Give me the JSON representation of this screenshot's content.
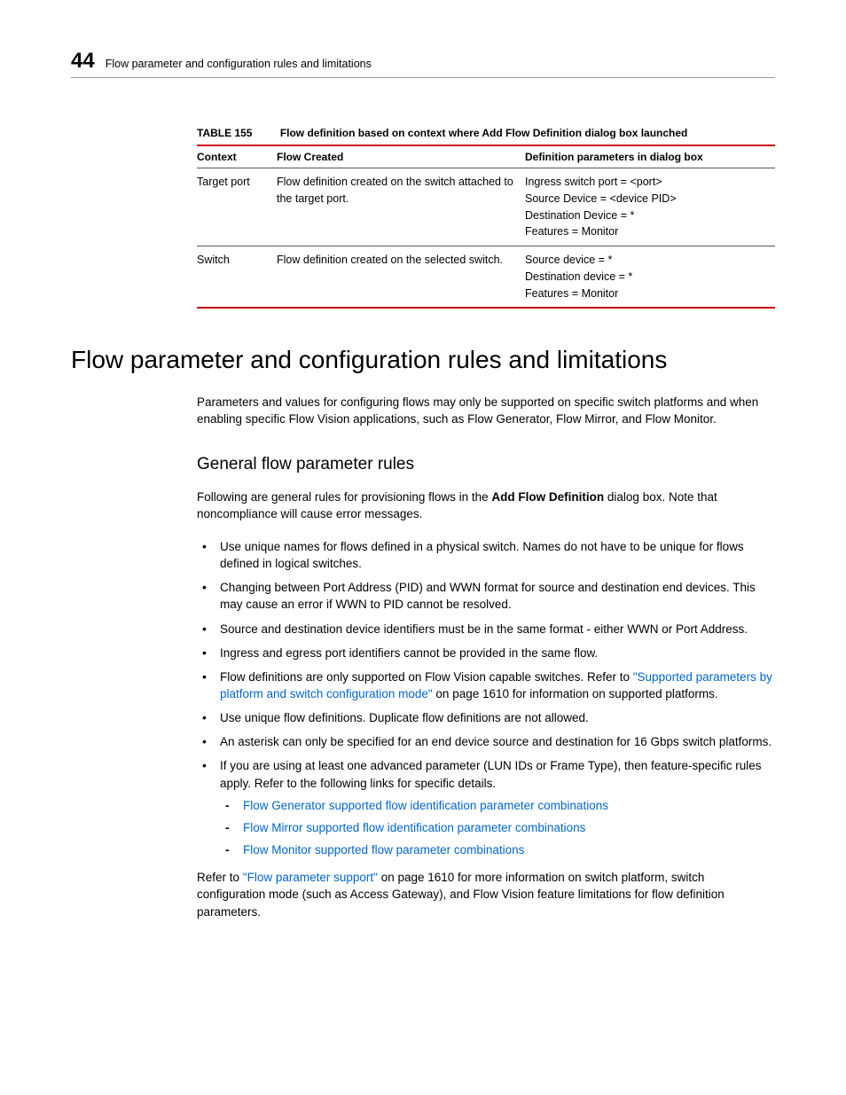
{
  "header": {
    "page_number": "44",
    "running_title": "Flow parameter and configuration rules and limitations"
  },
  "table": {
    "label": "TABLE 155",
    "caption": "Flow definition based on context where Add Flow Definition dialog box launched",
    "headers": [
      "Context",
      "Flow Created",
      "Definition parameters in dialog box"
    ],
    "rows": [
      {
        "context": "Target port",
        "flow_created": "Flow definition created on the switch attached to the target port.",
        "params": "Ingress switch port = <port>\nSource Device = <device PID>\nDestination Device = *\nFeatures = Monitor"
      },
      {
        "context": "Switch",
        "flow_created": "Flow definition created on the selected switch.",
        "params": "Source device = *\nDestination device = *\nFeatures = Monitor"
      }
    ]
  },
  "section": {
    "title": "Flow parameter and configuration rules and limitations",
    "intro": "Parameters and values for configuring flows may only be supported on specific switch platforms and when enabling specific Flow Vision applications, such as Flow Generator, Flow Mirror, and Flow Monitor.",
    "sub_title": "General flow parameter rules",
    "sub_intro_pre": "Following are general rules for provisioning flows in the ",
    "sub_intro_bold": "Add Flow Definition",
    "sub_intro_post": " dialog box. Note that noncompliance will cause error messages.",
    "bullets": {
      "b0": "Use unique names for flows defined in a physical switch. Names do not have to be unique for flows defined in logical switches.",
      "b1": "Changing between Port Address (PID) and WWN format for source and destination end devices. This may cause an error if WWN to PID cannot be resolved.",
      "b2": "Source and destination device identifiers must be in the same format - either WWN or Port Address.",
      "b3": "Ingress and egress port identifiers cannot be provided in the same flow.",
      "b4_pre": "Flow definitions are only supported on Flow Vision capable switches. Refer to ",
      "b4_link": "\"Supported parameters by platform and switch configuration mode\"",
      "b4_post": " on page 1610 for information on supported platforms.",
      "b5": "Use unique flow definitions. Duplicate flow definitions are not allowed.",
      "b6": "An asterisk can only be specified for an end device source and destination for 16 Gbps switch platforms.",
      "b7": "If you are using at least one advanced parameter (LUN IDs or Frame Type), then feature-specific rules apply. Refer to the following links for specific details.",
      "b7_sub0": "Flow Generator supported flow identification parameter combinations",
      "b7_sub1": "Flow Mirror supported flow identification parameter combinations",
      "b7_sub2": "Flow Monitor supported flow parameter combinations"
    },
    "outro_pre": "Refer to ",
    "outro_link": "\"Flow parameter support\"",
    "outro_post": " on page 1610 for more information on switch platform, switch configuration mode (such as Access Gateway), and Flow Vision feature limitations for flow definition parameters."
  }
}
